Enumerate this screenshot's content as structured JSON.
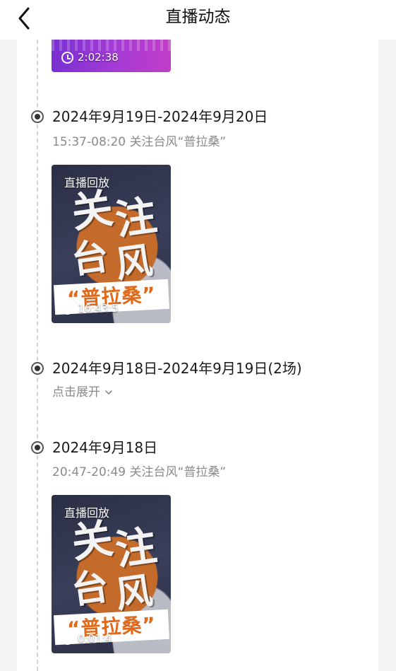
{
  "header": {
    "title": "直播动态"
  },
  "top_item": {
    "duration": "2:02:38"
  },
  "items": [
    {
      "date": "2024年9月19日-2024年9月20日",
      "subtitle": "15:37-08:20 关注台风“普拉桑”",
      "badge": "直播回放",
      "duration": "16:43:5",
      "art_text_1": "关",
      "art_text_2": "注",
      "art_text_3": "台",
      "art_text_4": "风",
      "art_name": "“普拉桑”"
    },
    {
      "date": "2024年9月18日-2024年9月19日(2场)",
      "expand_label": "点击展开"
    },
    {
      "date": "2024年9月18日",
      "subtitle": "20:47-20:49 关注台风“普拉桑”",
      "badge": "直播回放",
      "duration": "0:01:4",
      "art_text_1": "关",
      "art_text_2": "注",
      "art_text_3": "台",
      "art_text_4": "风",
      "art_name": "“普拉桑”"
    }
  ],
  "icons": {
    "back": "chevron-left-icon",
    "expand": "chevron-down-icon",
    "clock": "clock-icon"
  }
}
